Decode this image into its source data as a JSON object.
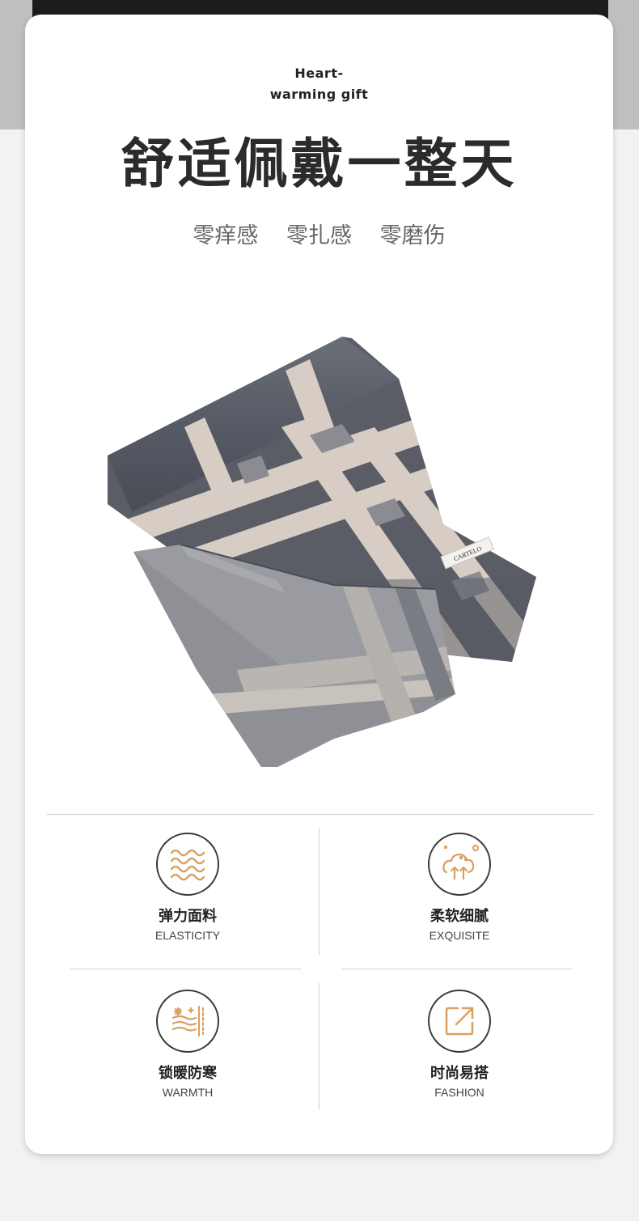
{
  "tagline": {
    "line1": "Heart-",
    "line2": "warming gift"
  },
  "headline": "舒适佩戴一整天",
  "subpoints": [
    "零痒感",
    "零扎感",
    "零磨伤"
  ],
  "product": {
    "label_text": "CARTELO"
  },
  "features": [
    {
      "title": "弹力面料",
      "subtitle": "ELASTICITY",
      "icon": "wave-icon"
    },
    {
      "title": "柔软细腻",
      "subtitle": "EXQUISITE",
      "icon": "cotton-cloud-icon"
    },
    {
      "title": "锁暖防寒",
      "subtitle": "WARMTH",
      "icon": "wind-snow-icon"
    },
    {
      "title": "时尚易搭",
      "subtitle": "FASHION",
      "icon": "share-arrow-icon"
    }
  ],
  "colors": {
    "accent": "#d9a162",
    "text": "#2b2b2b",
    "scarf_dark": "#5a5d66",
    "scarf_light": "#d8cdc4"
  }
}
